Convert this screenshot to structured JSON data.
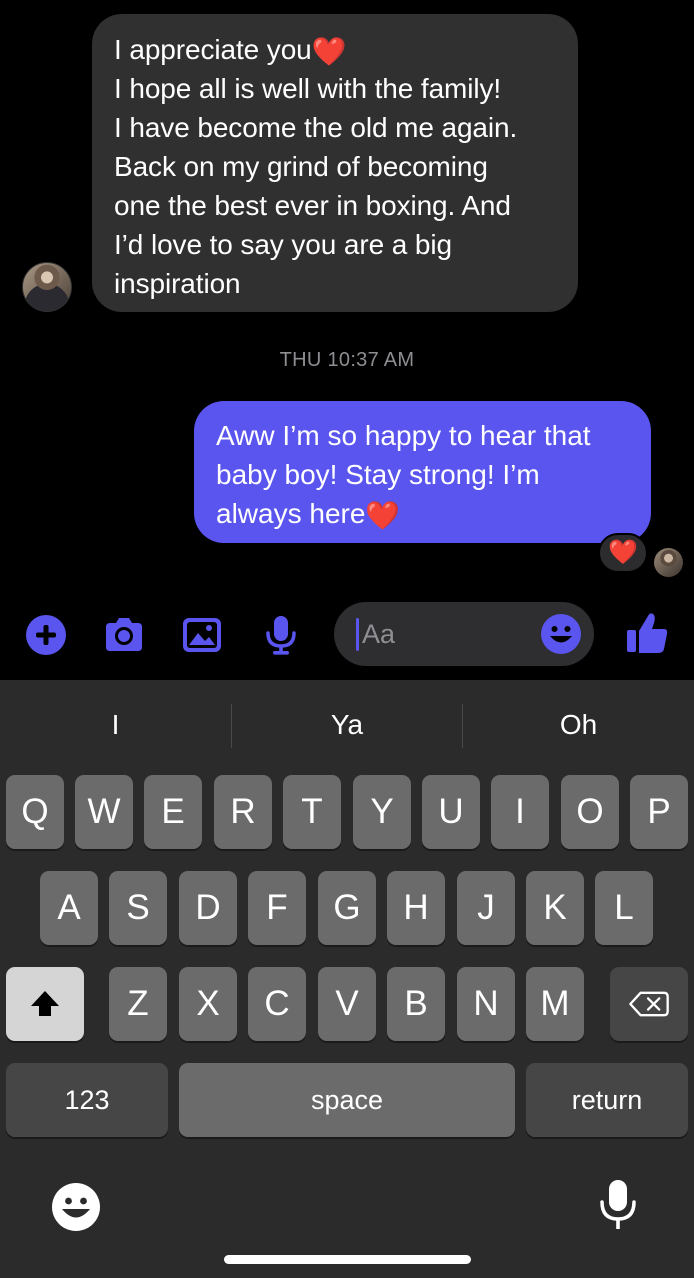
{
  "thread": {
    "incoming_message": {
      "lines": [
        "I appreciate you",
        "I hope all is well with the family!",
        "I have become the old me again.",
        "Back on my grind of becoming",
        "one the best ever in boxing. And",
        "I’d love to say you are a big",
        "inspiration"
      ],
      "heart": "❤️"
    },
    "timestamp": "THU 10:37 AM",
    "outgoing_message": {
      "lines": [
        "Aww I’m so happy to hear that",
        "baby boy! Stay strong! I’m",
        "always here"
      ],
      "heart": "❤️"
    },
    "reaction": "❤️"
  },
  "composer": {
    "placeholder": "Aa",
    "accent_color": "#5a55ee",
    "tools": [
      "plus-circle-icon",
      "camera-icon",
      "photo-icon",
      "microphone-icon"
    ],
    "send_icon": "thumbs-up-icon"
  },
  "keyboard": {
    "suggestions": [
      "I",
      "Ya",
      "Oh"
    ],
    "row1": [
      "Q",
      "W",
      "E",
      "R",
      "T",
      "Y",
      "U",
      "I",
      "O",
      "P"
    ],
    "row2": [
      "A",
      "S",
      "D",
      "F",
      "G",
      "H",
      "J",
      "K",
      "L"
    ],
    "row3": [
      "Z",
      "X",
      "C",
      "V",
      "B",
      "N",
      "M"
    ],
    "numbers_label": "123",
    "space_label": "space",
    "return_label": "return"
  }
}
